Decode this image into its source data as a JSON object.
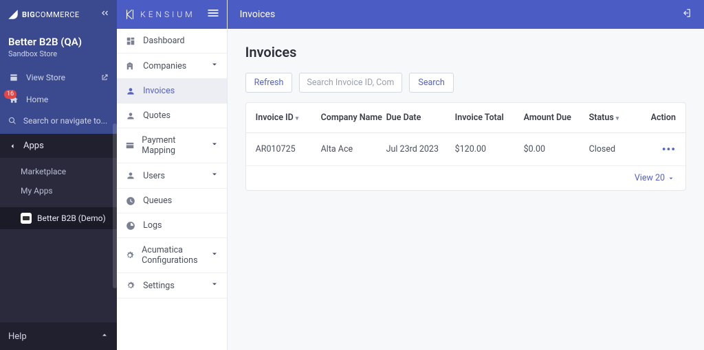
{
  "bc": {
    "brand": "COMMERCE",
    "brand_prefix": "BIG",
    "store_name": "Better B2B (QA)",
    "store_type": "Sandbox Store",
    "view_store": "View Store",
    "home": "Home",
    "home_badge": "16",
    "search_placeholder": "Search or navigate to...",
    "apps_heading": "Apps",
    "marketplace": "Marketplace",
    "my_apps": "My Apps",
    "app_name": "Better B2B (Demo)",
    "help": "Help"
  },
  "ks": {
    "brand": "KENSIUM",
    "items": [
      {
        "label": "Dashboard",
        "expandable": false,
        "active": false,
        "icon": "dashboard"
      },
      {
        "label": "Companies",
        "expandable": true,
        "active": false,
        "icon": "company"
      },
      {
        "label": "Invoices",
        "expandable": false,
        "active": true,
        "icon": "person"
      },
      {
        "label": "Quotes",
        "expandable": false,
        "active": false,
        "icon": "person"
      },
      {
        "label": "Payment Mapping",
        "expandable": true,
        "active": false,
        "icon": "card"
      },
      {
        "label": "Users",
        "expandable": true,
        "active": false,
        "icon": "person"
      },
      {
        "label": "Queues",
        "expandable": false,
        "active": false,
        "icon": "queue"
      },
      {
        "label": "Logs",
        "expandable": false,
        "active": false,
        "icon": "logs"
      },
      {
        "label": "Acumatica Configurations",
        "expandable": true,
        "active": false,
        "icon": "gear"
      },
      {
        "label": "Settings",
        "expandable": true,
        "active": false,
        "icon": "gear"
      }
    ]
  },
  "main": {
    "breadcrumb": "Invoices",
    "title": "Invoices",
    "refresh": "Refresh",
    "search_placeholder": "Search Invoice ID, Company",
    "search_btn": "Search",
    "view_label": "View 20",
    "columns": {
      "invoice_id": "Invoice ID",
      "company": "Company Name",
      "due": "Due Date",
      "total": "Invoice Total",
      "amount_due": "Amount Due",
      "status": "Status",
      "action": "Action"
    },
    "rows": [
      {
        "id": "AR010725",
        "company": "Alta Ace",
        "due": "Jul 23rd 2023",
        "total": "$120.00",
        "amount_due": "$0.00",
        "status": "Closed"
      }
    ]
  }
}
